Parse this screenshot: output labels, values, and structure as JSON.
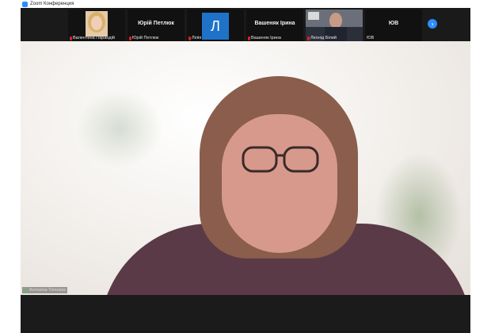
{
  "window": {
    "title": "Zoom Конференция"
  },
  "participants": [
    {
      "name": "Валентина Парандій",
      "display": "video"
    },
    {
      "name": "Юрій Петлюк",
      "display": "name",
      "label": "Юрій Петлюк"
    },
    {
      "name": "Лілія",
      "display": "avatar",
      "initial": "Л"
    },
    {
      "name": "Вашеняк Ірина",
      "display": "name",
      "label": "Вашеняк Ірина"
    },
    {
      "name": "Леонід Білий",
      "display": "video"
    },
    {
      "name": "ЮВ",
      "display": "name",
      "label": "ЮВ"
    }
  ],
  "navigation": {
    "next_icon": "chevron-right-icon",
    "next_glyph": "›"
  },
  "active_speaker": {
    "name": "Антоніна Тополюк"
  },
  "colors": {
    "accent": "#2d8cff",
    "muted_mic": "#e02020",
    "avatar_bg": "#1e73c8"
  }
}
